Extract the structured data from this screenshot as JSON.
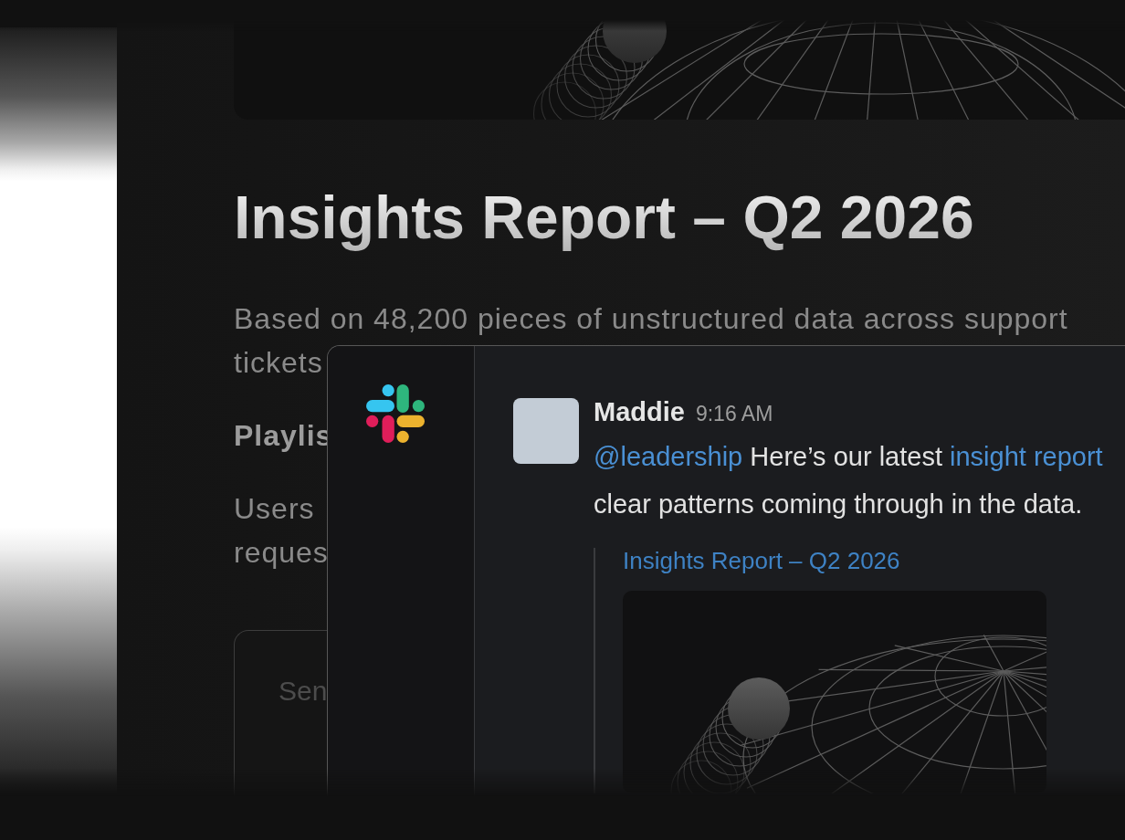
{
  "report": {
    "title": "Insights Report – Q2 2026",
    "summary_lines": [
      "Based on 48,200 pieces of unstructured data across support",
      "tickets"
    ],
    "section_heading": "Playlis",
    "body_lines": [
      "Users",
      "reques"
    ],
    "card": {
      "label": "Sen"
    }
  },
  "chat": {
    "message": {
      "author": "Maddie",
      "time": "9:16 AM",
      "segments": [
        {
          "kind": "mention",
          "text": "@leadership"
        },
        {
          "kind": "text",
          "text": " Here’s our latest "
        },
        {
          "kind": "link",
          "text": "insight report"
        },
        {
          "kind": "text",
          "text": " clear patterns coming through in the data."
        }
      ],
      "attachment": {
        "title": "Insights Report – Q2 2026"
      }
    }
  }
}
